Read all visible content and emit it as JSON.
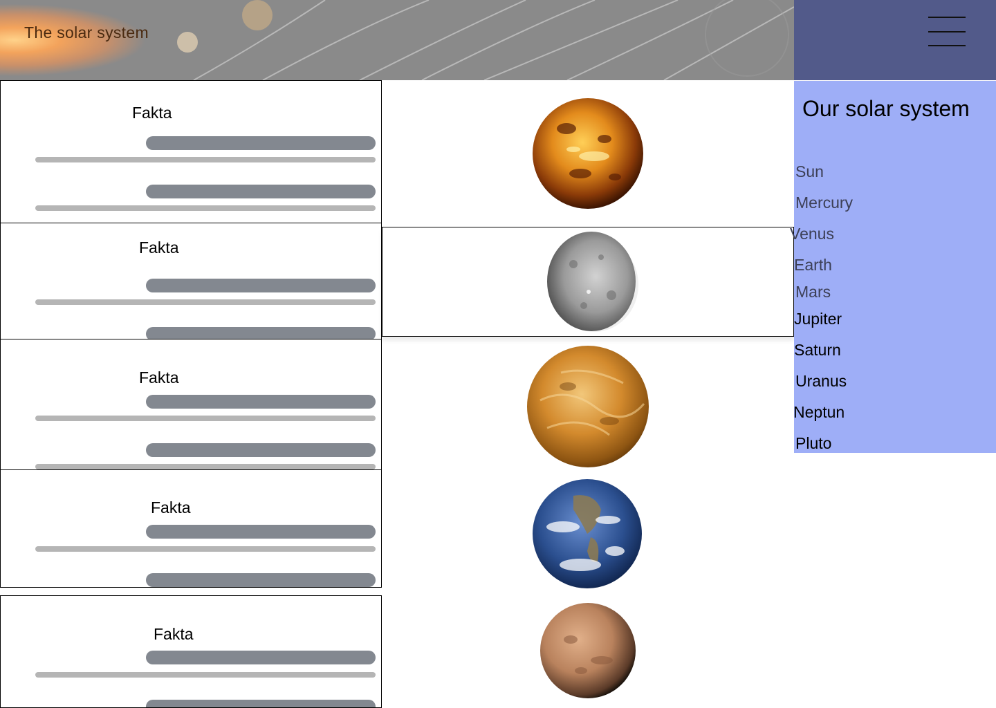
{
  "header": {
    "title": "The solar system",
    "menu_icon": "hamburger-menu-icon"
  },
  "fact_cards": [
    {
      "title": "Fakta"
    },
    {
      "title": "Fakta"
    },
    {
      "title": "Fakta"
    },
    {
      "title": "Fakta"
    },
    {
      "title": "Fakta"
    }
  ],
  "planets": [
    {
      "name": "Venus",
      "icon": "venus-planet-image"
    },
    {
      "name": "Mercury",
      "icon": "mercury-planet-image",
      "selected": true
    },
    {
      "name": "Venus",
      "icon": "venus-planet-image"
    },
    {
      "name": "Earth",
      "icon": "earth-planet-image"
    },
    {
      "name": "Mars",
      "icon": "mars-planet-image"
    }
  ],
  "sidenav": {
    "title": "Our solar system",
    "items": [
      {
        "label": "Sun"
      },
      {
        "label": "Mercury"
      },
      {
        "label": "Venus"
      },
      {
        "label": "Earth"
      },
      {
        "label": "Mars"
      },
      {
        "label": "Jupiter"
      },
      {
        "label": "Saturn"
      },
      {
        "label": "Uranus"
      },
      {
        "label": "Neptun"
      },
      {
        "label": "Pluto"
      }
    ]
  },
  "colors": {
    "header_gray": "#8a8a8a",
    "header_right": "#525a8a",
    "sidenav_bg": "#9eaef7",
    "bar_dark": "#838890",
    "bar_light": "#b5b5b5"
  }
}
